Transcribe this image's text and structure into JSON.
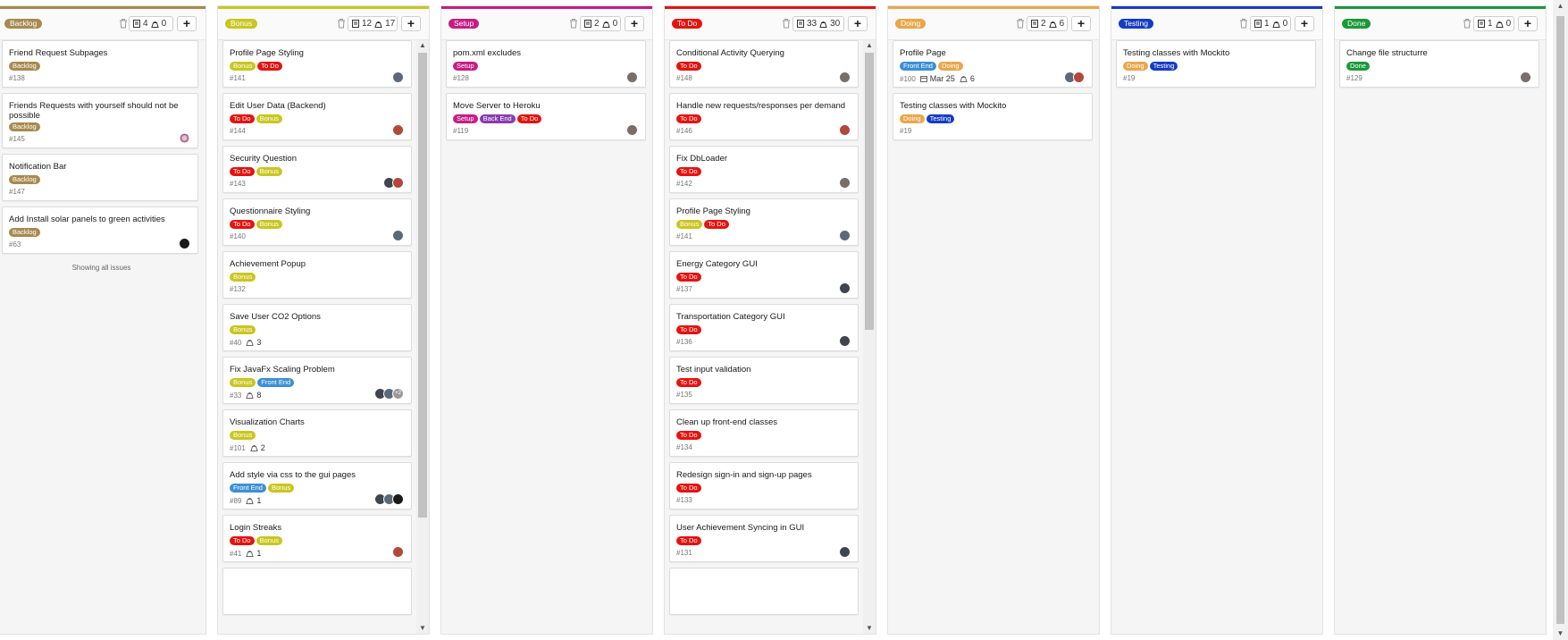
{
  "colors": {
    "backlog": "#a88a4f",
    "bonus": "#c9c61f",
    "setup": "#c71c85",
    "todo": "#e5130f",
    "doing": "#eaa64a",
    "testing": "#163cc4",
    "done": "#1a9a38",
    "front_end": "#3c8fd4",
    "back_end": "#8a3bb0"
  },
  "icons": {
    "trash": "trash-icon",
    "issues": "issue-icon",
    "weight": "weight-icon",
    "add": "plus-icon",
    "due": "calendar-icon"
  },
  "columns": [
    {
      "label": "Backlog",
      "issues": "4",
      "weight": "0",
      "add": "+",
      "footer": "Showing all issues",
      "cards": [
        {
          "title": "Friend Request Subpages",
          "labels": [
            "Backlog"
          ],
          "id": "#138"
        },
        {
          "title": "Friends Requests with yourself should not be possible",
          "labels": [
            "Backlog"
          ],
          "id": "#145"
        },
        {
          "title": "Notification Bar",
          "labels": [
            "Backlog"
          ],
          "id": "#147"
        },
        {
          "title": "Add Install solar panels to green activities",
          "labels": [
            "Backlog"
          ],
          "id": "#63"
        }
      ]
    },
    {
      "label": "Bonus",
      "issues": "12",
      "weight": "17",
      "add": "+",
      "cards": [
        {
          "title": "Profile Page Styling",
          "labels": [
            "Bonus",
            "To Do"
          ],
          "id": "#141"
        },
        {
          "title": "Edit User Data (Backend)",
          "labels": [
            "To Do",
            "Bonus"
          ],
          "id": "#144"
        },
        {
          "title": "Security Question",
          "labels": [
            "To Do",
            "Bonus"
          ],
          "id": "#143"
        },
        {
          "title": "Questionnaire Styling",
          "labels": [
            "To Do",
            "Bonus"
          ],
          "id": "#140"
        },
        {
          "title": "Achievement Popup",
          "labels": [
            "Bonus"
          ],
          "id": "#132"
        },
        {
          "title": "Save User CO2 Options",
          "labels": [
            "Bonus"
          ],
          "id": "#40",
          "weight": "3"
        },
        {
          "title": "Fix JavaFx Scaling Problem",
          "labels": [
            "Bonus",
            "Front End"
          ],
          "id": "#33",
          "weight": "8",
          "more": "+2"
        },
        {
          "title": "Visualization Charts",
          "labels": [
            "Bonus"
          ],
          "id": "#101",
          "weight": "2"
        },
        {
          "title": "Add style via css to the gui pages",
          "labels": [
            "Front End",
            "Bonus"
          ],
          "id": "#89",
          "weight": "1"
        },
        {
          "title": "Login Streaks",
          "labels": [
            "To Do",
            "Bonus"
          ],
          "id": "#41",
          "weight": "1"
        }
      ]
    },
    {
      "label": "Setup",
      "issues": "2",
      "weight": "0",
      "add": "+",
      "cards": [
        {
          "title": "pom.xml excludes",
          "labels": [
            "Setup"
          ],
          "id": "#128"
        },
        {
          "title": "Move Server to Heroku",
          "labels": [
            "Setup",
            "Back End",
            "To Do"
          ],
          "id": "#119"
        }
      ]
    },
    {
      "label": "To Do",
      "issues": "33",
      "weight": "30",
      "add": "+",
      "cards": [
        {
          "title": "Conditional Activity Querying",
          "labels": [
            "To Do"
          ],
          "id": "#148"
        },
        {
          "title": "Handle new requests/responses per demand",
          "labels": [
            "To Do"
          ],
          "id": "#146"
        },
        {
          "title": "Fix DbLoader",
          "labels": [
            "To Do"
          ],
          "id": "#142"
        },
        {
          "title": "Profile Page Styling",
          "labels": [
            "Bonus",
            "To Do"
          ],
          "id": "#141"
        },
        {
          "title": "Energy Category GUI",
          "labels": [
            "To Do"
          ],
          "id": "#137"
        },
        {
          "title": "Transportation Category GUI",
          "labels": [
            "To Do"
          ],
          "id": "#136"
        },
        {
          "title": "Test input validation",
          "labels": [
            "To Do"
          ],
          "id": "#135"
        },
        {
          "title": "Clean up front-end classes",
          "labels": [
            "To Do"
          ],
          "id": "#134"
        },
        {
          "title": "Redesign sign-in and sign-up pages",
          "labels": [
            "To Do"
          ],
          "id": "#133"
        },
        {
          "title": "User Achievement Syncing in GUI",
          "labels": [
            "To Do"
          ],
          "id": "#131"
        }
      ]
    },
    {
      "label": "Doing",
      "issues": "2",
      "weight": "6",
      "add": "+",
      "cards": [
        {
          "title": "Profile Page",
          "labels": [
            "Front End",
            "Doing"
          ],
          "id": "#100",
          "due": "Mar 25",
          "weight": "6"
        },
        {
          "title": "Testing classes with Mockito",
          "labels": [
            "Doing",
            "Testing"
          ],
          "id": "#19"
        }
      ]
    },
    {
      "label": "Testing",
      "issues": "1",
      "weight": "0",
      "add": "+",
      "cards": [
        {
          "title": "Testing classes with Mockito",
          "labels": [
            "Doing",
            "Testing"
          ],
          "id": "#19"
        }
      ]
    },
    {
      "label": "Done",
      "issues": "1",
      "weight": "0",
      "add": "+",
      "cards": [
        {
          "title": "Change file structurre",
          "labels": [
            "Done"
          ],
          "id": "#129"
        }
      ]
    }
  ]
}
